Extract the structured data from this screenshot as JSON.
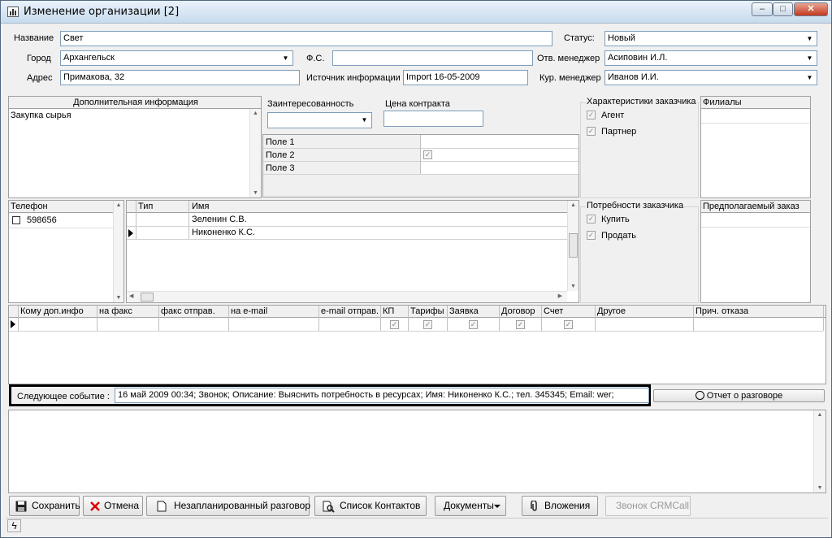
{
  "window": {
    "title": "Изменение организации [2]",
    "minimize": "–",
    "maximize": "□",
    "close": "✕"
  },
  "org": {
    "name_label": "Название",
    "name_value": "Свет",
    "status_label": "Статус:",
    "status_value": "Новый",
    "city_label": "Город",
    "city_value": "Архангельск",
    "fs_label": "Ф.С.",
    "fs_value": "",
    "manager_label": "Отв. менеджер",
    "manager_value": "Асиповин И.Л.",
    "address_label": "Адрес",
    "address_value": "Примакова, 32",
    "source_label": "Источник информации",
    "source_value": "Import 16-05-2009",
    "curator_label": "Кур. менеджер",
    "curator_value": "Иванов И.И."
  },
  "addinfo": {
    "header": "Дополнительная информация",
    "text": "Закупка сырья"
  },
  "interest": {
    "label": "Заинтересованность",
    "value": "",
    "price_label": "Цена контракта",
    "price_value": ""
  },
  "fields": [
    {
      "name": "Поле 1",
      "checked": false
    },
    {
      "name": "Поле 2",
      "checked": true
    },
    {
      "name": "Поле 3",
      "checked": false
    }
  ],
  "characteristics": {
    "title": "Характеристики заказчика",
    "items": [
      {
        "label": "Агент",
        "checked": true
      },
      {
        "label": "Партнер",
        "checked": true
      }
    ]
  },
  "branches": {
    "header": "Филиалы"
  },
  "phones": {
    "header": "Телефон",
    "items": [
      {
        "number": "598656"
      }
    ]
  },
  "contacts": {
    "col_type": "Тип",
    "col_name": "Имя",
    "rows": [
      {
        "type": "",
        "name": "Зеленин С.В.",
        "current": false
      },
      {
        "type": "",
        "name": "Никоненко К.С.",
        "current": true
      }
    ]
  },
  "needs": {
    "title": "Потребности заказчика",
    "items": [
      {
        "label": "Купить",
        "checked": true
      },
      {
        "label": "Продать",
        "checked": true
      }
    ]
  },
  "expected": {
    "header": "Предполагаемый заказ"
  },
  "distribution": {
    "columns": [
      "Кому доп.инфо",
      "на факс",
      "факс отправ.",
      "на e-mail",
      "e-mail отправ.",
      "КП",
      "Тарифы",
      "Заявка",
      "Договор",
      "Счет",
      "Другое",
      "Прич. отказа"
    ]
  },
  "event": {
    "label": "Следующее событие :",
    "value": "16 май 2009 00:34; Звонок; Описание: Выяснить потребность в ресурсах; Имя: Никоненко К.С.; тел. 345345; Email: wer;",
    "report_button": "Отчет о разговоре"
  },
  "buttons": {
    "save": "Сохранить",
    "cancel": "Отмена",
    "unplanned": "Незапланированный разговор",
    "contacts_list": "Список Контактов",
    "documents": "Документы",
    "attachments": "Вложения",
    "crmcall": "Звонок CRMCall"
  },
  "colors": {
    "title_gradient_top": "#e9f2fb",
    "close_red": "#c23a1f",
    "input_border": "#7f9db9",
    "event_border": "#000000"
  }
}
